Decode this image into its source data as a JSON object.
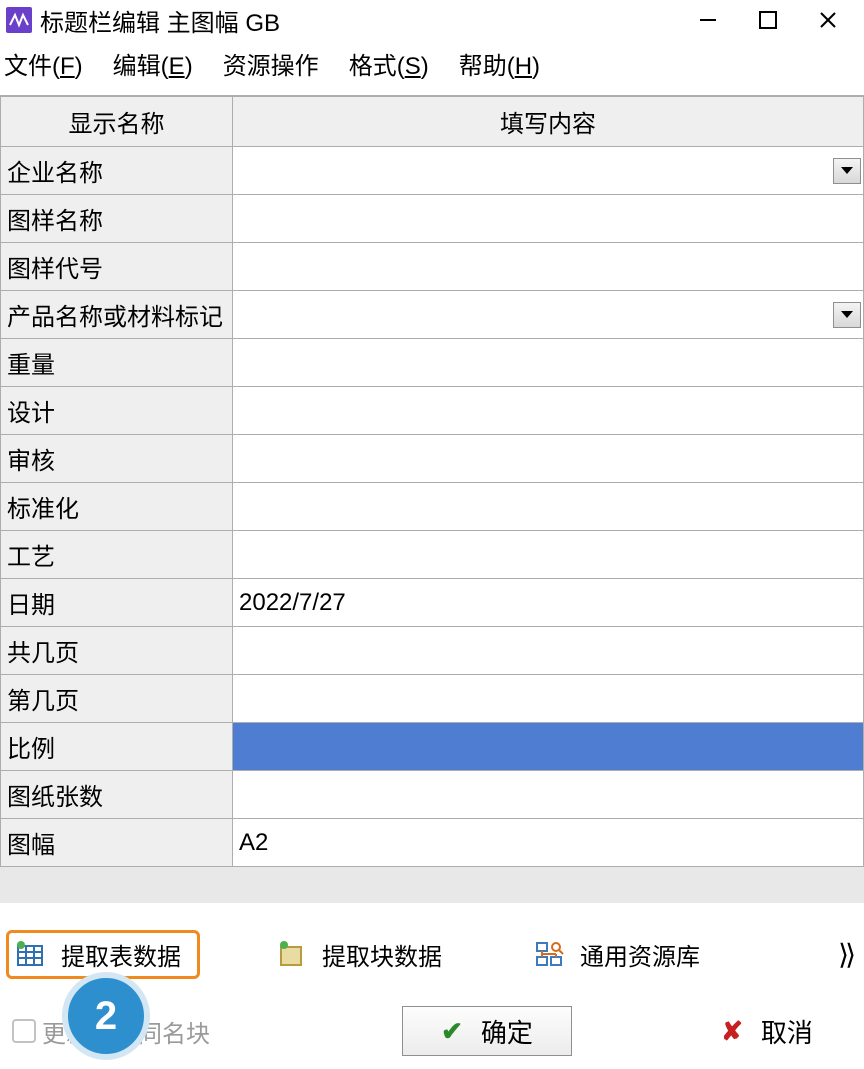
{
  "window": {
    "title": "标题栏编辑 主图幅 GB"
  },
  "menubar": {
    "file": {
      "label": "文件",
      "hotkey": "F"
    },
    "edit": {
      "label": "编辑",
      "hotkey": "E"
    },
    "resource": {
      "label": "资源操作"
    },
    "format": {
      "label": "格式",
      "hotkey": "S"
    },
    "help": {
      "label": "帮助",
      "hotkey": "H"
    }
  },
  "table": {
    "header_name": "显示名称",
    "header_value": "填写内容",
    "rows": [
      {
        "name": "企业名称",
        "value": "",
        "dropdown": true
      },
      {
        "name": "图样名称",
        "value": ""
      },
      {
        "name": "图样代号",
        "value": ""
      },
      {
        "name": "产品名称或材料标记",
        "value": "",
        "dropdown": true
      },
      {
        "name": "重量",
        "value": ""
      },
      {
        "name": "设计",
        "value": ""
      },
      {
        "name": "审核",
        "value": ""
      },
      {
        "name": "标准化",
        "value": ""
      },
      {
        "name": "工艺",
        "value": ""
      },
      {
        "name": "日期",
        "value": "2022/7/27"
      },
      {
        "name": "共几页",
        "value": ""
      },
      {
        "name": "第几页",
        "value": ""
      },
      {
        "name": "比例",
        "value": "",
        "selected": true
      },
      {
        "name": "图纸张数",
        "value": ""
      },
      {
        "name": "图幅",
        "value": "A2"
      }
    ]
  },
  "toolbar": {
    "extract_table": "提取表数据",
    "extract_block": "提取块数据",
    "resource_lib": "通用资源库"
  },
  "step_badge": "2",
  "bottom": {
    "checkbox": "更新所有同名块",
    "ok": "确定",
    "cancel": "取消"
  }
}
